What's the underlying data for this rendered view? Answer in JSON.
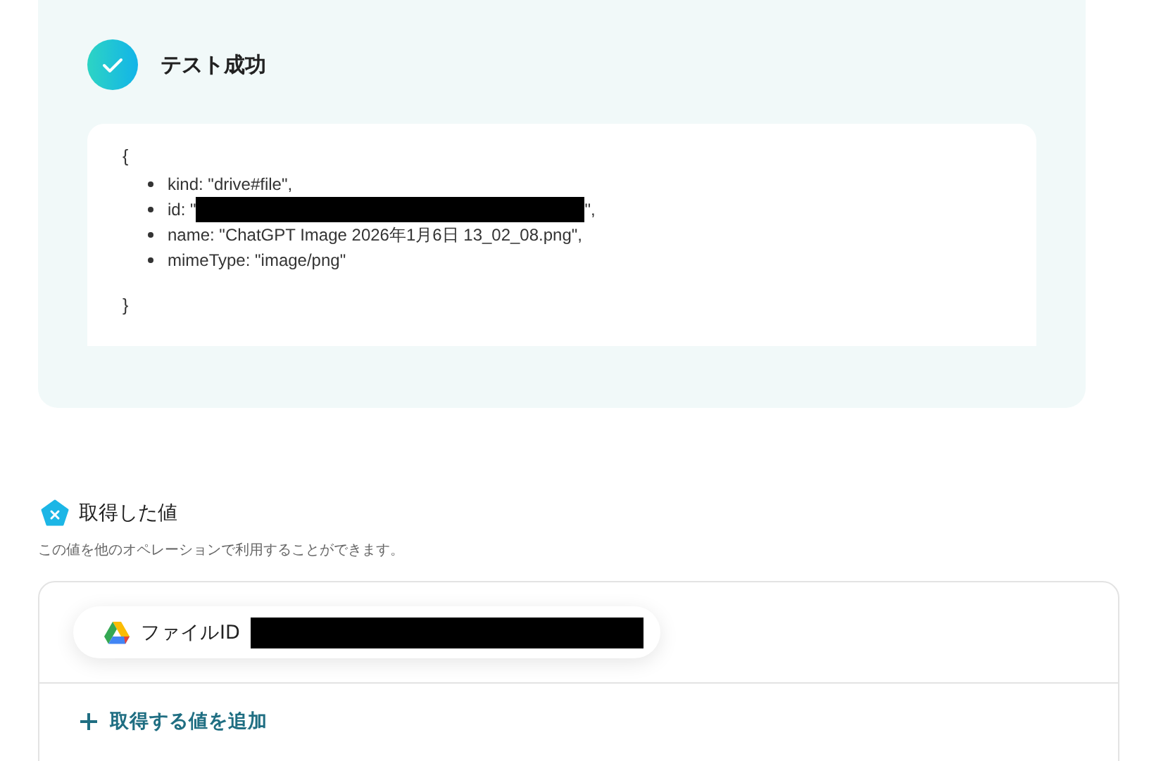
{
  "test_result": {
    "title": "テスト成功",
    "open_brace": "{",
    "close_brace": "}",
    "items": [
      {
        "text": "kind: \"drive#file\","
      },
      {
        "text": "id: \"",
        "redacted": true,
        "after": "\","
      },
      {
        "text": "name: \"ChatGPT Image 2026年1月6日 13_02_08.png\","
      },
      {
        "text": "mimeType: \"image/png\""
      }
    ]
  },
  "values": {
    "title": "取得した値",
    "description": "この値を他のオペレーションで利用することができます。",
    "chips": [
      {
        "label": "ファイルID",
        "redacted": true
      }
    ],
    "add_button": "取得する値を追加"
  }
}
